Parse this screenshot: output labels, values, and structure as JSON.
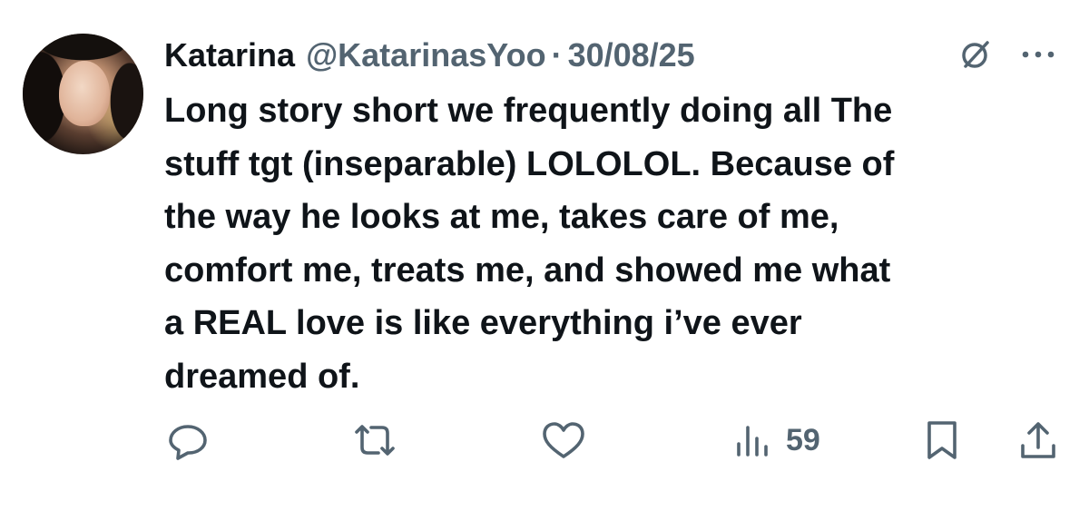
{
  "author": {
    "display_name": "Katarina",
    "handle": "@KatarinasYoo",
    "separator": "·",
    "date": "30/08/25"
  },
  "tweet": {
    "text": "Long story short we frequently doing all The\nstuff tgt (inseparable) LOLOLOL. Because of\nthe way he looks at me, takes care of me,\ncomfort me, treats me, and showed me what\na REAL love is like everything i’ve ever\ndreamed of."
  },
  "metrics": {
    "views": "59"
  },
  "icons": {
    "header": [
      "grok-icon",
      "more-icon"
    ],
    "actions": [
      "reply-icon",
      "retweet-icon",
      "like-icon",
      "views-icon",
      "bookmark-icon",
      "share-icon"
    ]
  },
  "colors": {
    "text": "#0f1419",
    "secondary": "#536471",
    "background": "#ffffff"
  }
}
